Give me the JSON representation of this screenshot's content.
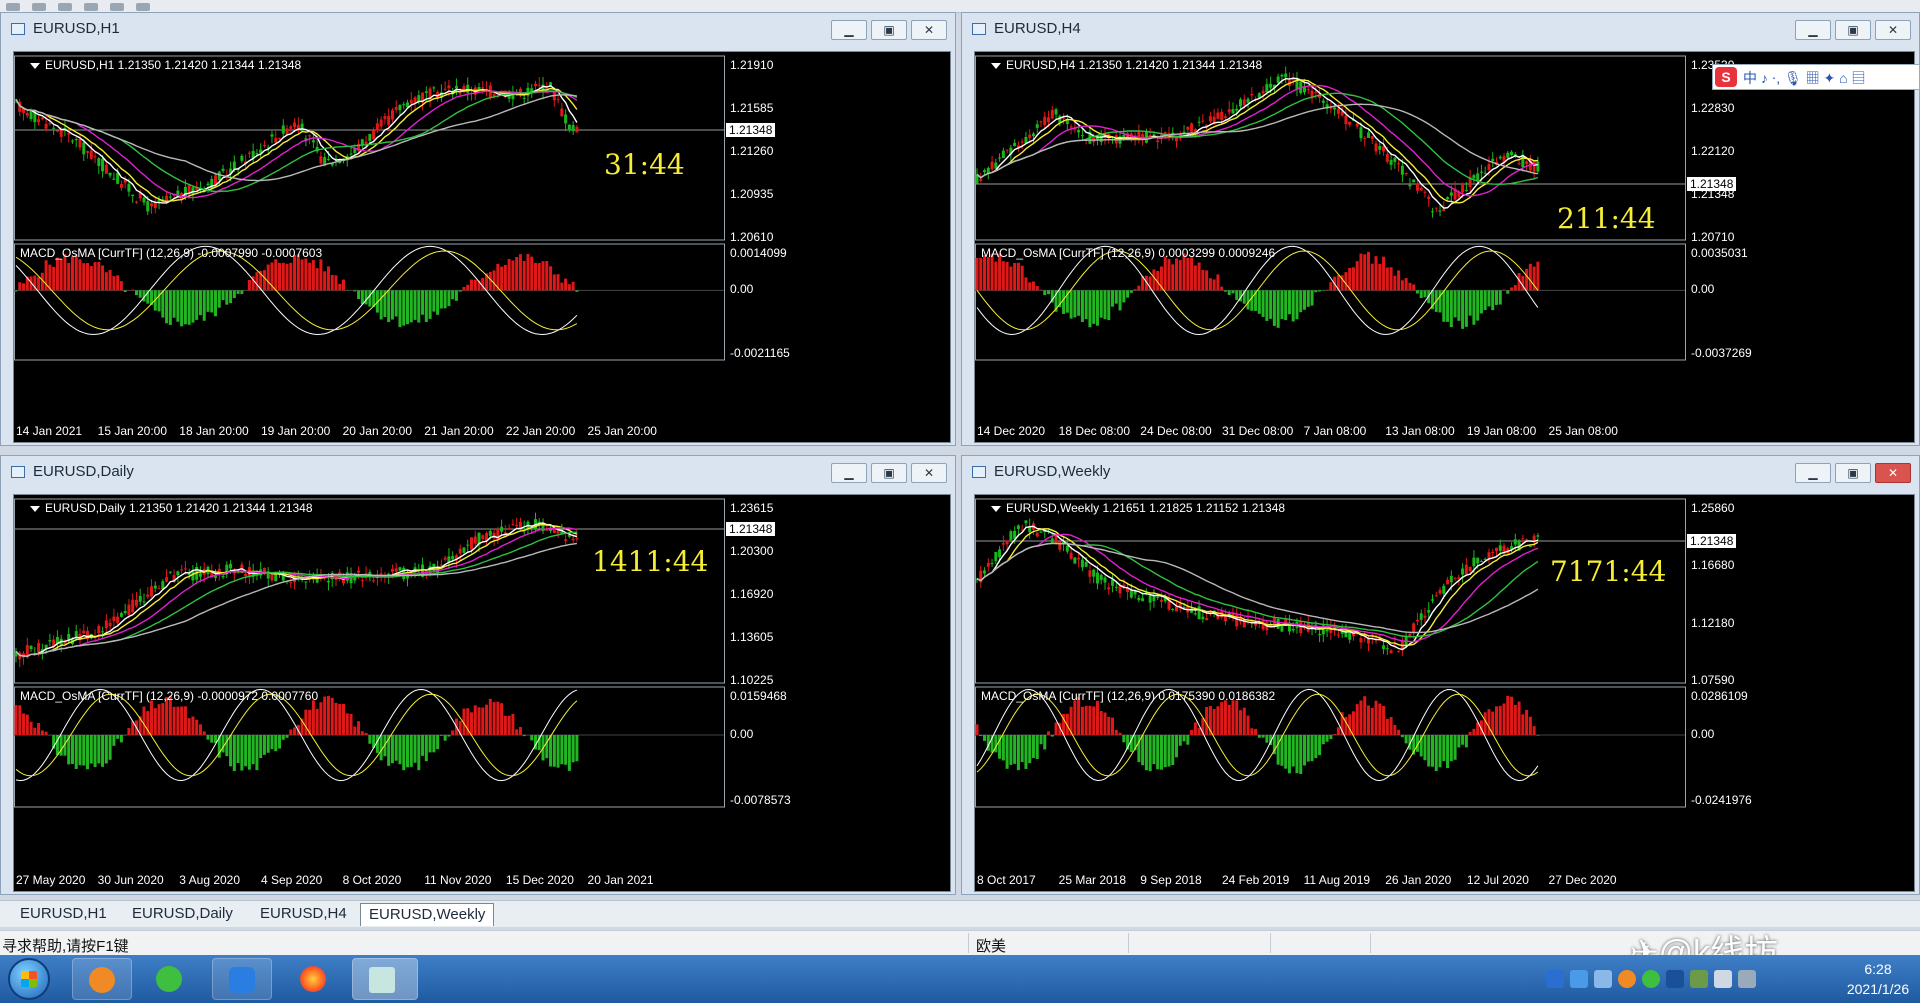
{
  "colors": {
    "bull": "#18b81c",
    "bear": "#e01818",
    "macd_pos": "#e01818",
    "macd_neg": "#22b722",
    "ma_white": "#ffffff",
    "ma_yellow": "#f6ee35",
    "ma_magenta": "#e020d0",
    "ma_green": "#30c040",
    "ma_gray": "#b8b8b8",
    "countdown": "#f6ee35"
  },
  "windows": [
    {
      "id": "h1",
      "title": "EURUSD,H1",
      "ohlc": "EURUSD,H1  1.21350 1.21420 1.21344 1.21348",
      "macd": "MACD_OsMA [CurrTF] (12,26,9) -0.0007990 -0.0007603",
      "price_labels": [
        "1.21910",
        "1.21585",
        "1.21260",
        "1.20935",
        "1.20610"
      ],
      "macd_labels": [
        "0.0014099",
        "0.00",
        "-0.0021165"
      ],
      "current_price": "1.21348",
      "countdown": "31:44",
      "dates": [
        "14 Jan 2021",
        "15 Jan 20:00",
        "18 Jan 20:00",
        "19 Jan 20:00",
        "20 Jan 20:00",
        "21 Jan 20:00",
        "22 Jan 20:00",
        "25 Jan 20:00"
      ]
    },
    {
      "id": "h4",
      "title": "EURUSD,H4",
      "ohlc": "EURUSD,H4  1.21350 1.21420 1.21344 1.21348",
      "macd": "MACD_OsMA [CurrTF] (12,26,9) 0.0003299 0.0009246",
      "price_labels": [
        "1.23530",
        "1.22830",
        "1.22120",
        "1.21348",
        "1.20710"
      ],
      "macd_labels": [
        "0.0035031",
        "0.00",
        "-0.0037269"
      ],
      "current_price": "1.21348",
      "countdown": "211:44",
      "dates": [
        "14 Dec 2020",
        "18 Dec 08:00",
        "24 Dec 08:00",
        "31 Dec 08:00",
        "7 Jan 08:00",
        "13 Jan 08:00",
        "19 Jan 08:00",
        "25 Jan 08:00"
      ]
    },
    {
      "id": "daily",
      "title": "EURUSD,Daily",
      "ohlc": "EURUSD,Daily  1.21350 1.21420 1.21344 1.21348",
      "macd": "MACD_OsMA [CurrTF] (12,26,9) -0.0000972 0.0007760",
      "price_labels": [
        "1.23615",
        "1.20300",
        "1.16920",
        "1.13605",
        "1.10225"
      ],
      "macd_labels": [
        "0.0159468",
        "0.00",
        "-0.0078573"
      ],
      "current_price": "1.21348",
      "countdown": "1411:44",
      "dates": [
        "27 May 2020",
        "30 Jun 2020",
        "3 Aug 2020",
        "4 Sep 2020",
        "8 Oct 2020",
        "11 Nov 2020",
        "15 Dec 2020",
        "20 Jan 2021"
      ]
    },
    {
      "id": "weekly",
      "title": "EURUSD,Weekly",
      "ohlc": "EURUSD,Weekly  1.21651 1.21825 1.21152 1.21348",
      "macd": "MACD_OsMA [CurrTF] (12,26,9) 0.0175390 0.0186382",
      "price_labels": [
        "1.25860",
        "1.16680",
        "1.12180",
        "1.07590"
      ],
      "macd_labels": [
        "0.0286109",
        "0.00",
        "-0.0241976"
      ],
      "current_price": "1.21348",
      "countdown": "7171:44",
      "dates": [
        "8 Oct 2017",
        "25 Mar 2018",
        "9 Sep 2018",
        "24 Feb 2019",
        "11 Aug 2019",
        "26 Jan 2020",
        "12 Jul 2020",
        "27 Dec 2020"
      ]
    }
  ],
  "tabs": [
    "EURUSD,H1",
    "EURUSD,Daily",
    "EURUSD,H4",
    "EURUSD,Weekly"
  ],
  "active_tab": "EURUSD,Weekly",
  "status": {
    "help": "寻求帮助,请按F1键",
    "profile": "欧美"
  },
  "taskbar": {
    "time": "6:28",
    "date": "2021/1/26"
  },
  "ime": {
    "logo": "S",
    "text": "中 ♪ ⋅, 🎙 ▦ ✦ ⌂ ▤"
  },
  "watermark": "@k线坊"
}
